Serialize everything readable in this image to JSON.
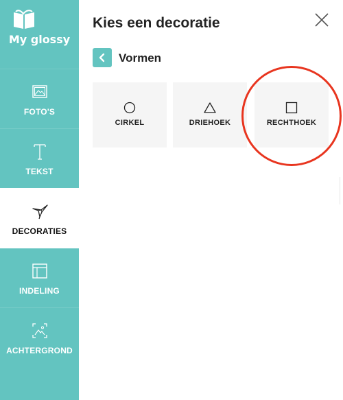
{
  "app": {
    "logo_text": "My glossy"
  },
  "sidebar": {
    "items": [
      {
        "label": "FOTO'S",
        "icon": "image-icon",
        "active": false
      },
      {
        "label": "TEKST",
        "icon": "text-icon",
        "active": false
      },
      {
        "label": "DECORATIES",
        "icon": "origami-bird-icon",
        "active": true
      },
      {
        "label": "INDELING",
        "icon": "layout-icon",
        "active": false
      },
      {
        "label": "ACHTERGROND",
        "icon": "background-image-icon",
        "active": false
      }
    ]
  },
  "panel": {
    "title": "Kies een decoratie",
    "subtitle": "Vormen",
    "shapes": [
      {
        "label": "CIRKEL",
        "icon": "circle-icon"
      },
      {
        "label": "DRIEHOEK",
        "icon": "triangle-icon"
      },
      {
        "label": "RECHTHOEK",
        "icon": "square-icon",
        "highlighted": true
      }
    ]
  },
  "colors": {
    "sidebar": "#63c4c0",
    "highlight": "#e8351f",
    "card": "#f5f5f5"
  }
}
